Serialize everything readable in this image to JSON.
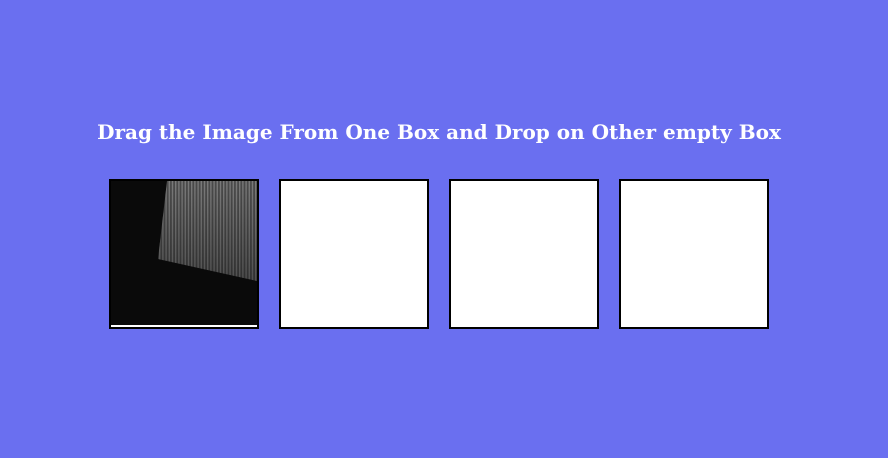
{
  "heading": "Drag the Image From One Box and Drop on Other empty Box",
  "colors": {
    "background": "#6a6ff0",
    "box_fill": "#ffffff",
    "box_border": "#000000",
    "heading_text": "#ffffff"
  },
  "boxes": [
    {
      "has_image": true
    },
    {
      "has_image": false
    },
    {
      "has_image": false
    },
    {
      "has_image": false
    }
  ]
}
